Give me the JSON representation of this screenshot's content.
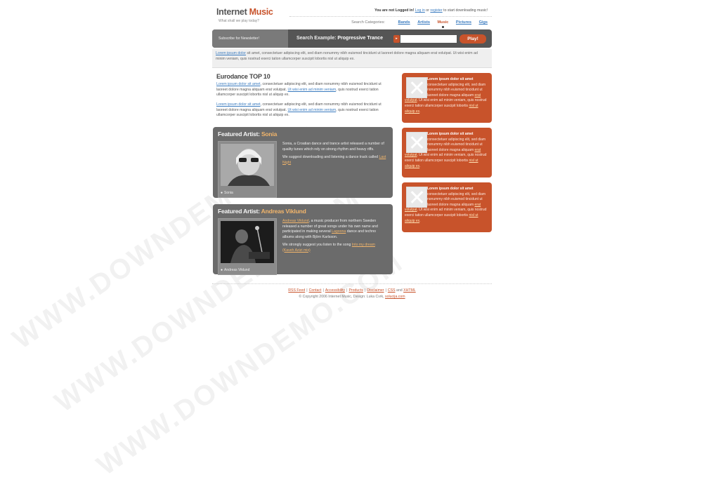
{
  "header": {
    "logo_part1": "Internet",
    "logo_part2": "Music",
    "tagline": "What shall we play today?",
    "login_status": "You are not Logged in!",
    "login_link": "Log in",
    "login_or": "or",
    "register_link": "register",
    "login_suffix": "to start downloading music!",
    "categories_label": "Search Categories:",
    "categories": [
      "Bands",
      "Artists",
      "Music",
      "Pictures",
      "Gigs"
    ],
    "active_category": "Music"
  },
  "search_bar": {
    "newsletter": "Subscribe for Newsletter!",
    "search_example_label": "Search Example:",
    "search_example_value": "Progressive Trance",
    "input_value": "",
    "play_button": "Play!"
  },
  "intro": {
    "link": "Lorem ipsum dolor",
    "text": " sit amet, consectetuer adipiscing elit, sed diam nonummy nibh euismod tincidunt ut laoreet dolore magna aliquam erat volutpat. Ut wisi enim ad minim veniam, quis nostrud exerci tation ullamcorper suscipit lobortis nisl ut aliquip ex."
  },
  "top10": {
    "title": "Eurodance TOP 10",
    "p1_link": "Lorem ipsum dolor sit amet",
    "p1_text": ", consectetuer adipiscing elit, sed diam nonummy nibh euismod tincidunt ut laoreet dolore magna aliquam erat volutpat.",
    "p1_link2": "Ut wisi enim ad minim veniam",
    "p1_text2": ", quis nostrud exerci tation ullamcorper suscipit lobortis nisl ut aliquip ex.",
    "p2_link": "Lorem ipsum dolor sit amet",
    "p2_text": ", consectetuer adipiscing elit, sed diam nonummy nibh euismod tincidunt ut laoreet dolore magna aliquam erat volutpat.",
    "p2_link2": "Ut wisi enim ad minim veniam",
    "p2_text2": ", quis nostrud exerci tation ullamcorper suscipit lobortis nisl ut aliquip ex."
  },
  "featured": [
    {
      "title_prefix": "Featured Artist:",
      "name": "Sonia",
      "caption": "Sonia",
      "p1": "Sonia, a Croatian dance and trance artist released a number of quality tunes which rely on strong rhythm and heavy riffs.",
      "p2_text": "We suggest downloading and listening a dance track called ",
      "p2_link": "Last Night"
    },
    {
      "title_prefix": "Featured Artist:",
      "name": "Andreas Viklund",
      "caption": "Andreas Viklund",
      "p1_link": "Andreas Viklund",
      "p1_text": ", a music producer from northern Sweden released a number of great songs under his own name and participated in making several ",
      "p1_link2": "Lagoona",
      "p1_text2": " dance and techno albums along with Björn Karlsson.",
      "p2_text": "We strongly suggest you listen to the song ",
      "p2_link": "Into my dream (Kaveh Azizi mix)"
    }
  ],
  "sidebar_box": {
    "title": "Lorem ipsum dolor sit amet",
    "text1": " consectetuer adipiscing elit, sed diam nonummy nibh euismod tincidunt ut laoreet dolore magna aliquam ",
    "link1": "erat volutpat",
    "text2": ". Ut wisi enim ad minim veniam, quis nostrud exerci tation ullamcorper suscipit lobortis ",
    "link2": "nisl ut aliquip ex",
    "text3": "."
  },
  "footer": {
    "links": [
      "RSS Feed",
      "Contact",
      "Accessibility",
      "Products",
      "Disclaimer",
      "CSS"
    ],
    "and": "and",
    "last_link": "XHTML",
    "copyright": "© Copyright 2006 Internet Music, Design: Luka Cvrk,",
    "credit_link": "solucija.com"
  },
  "watermark": "WWW.DOWNDEMO.COM"
}
